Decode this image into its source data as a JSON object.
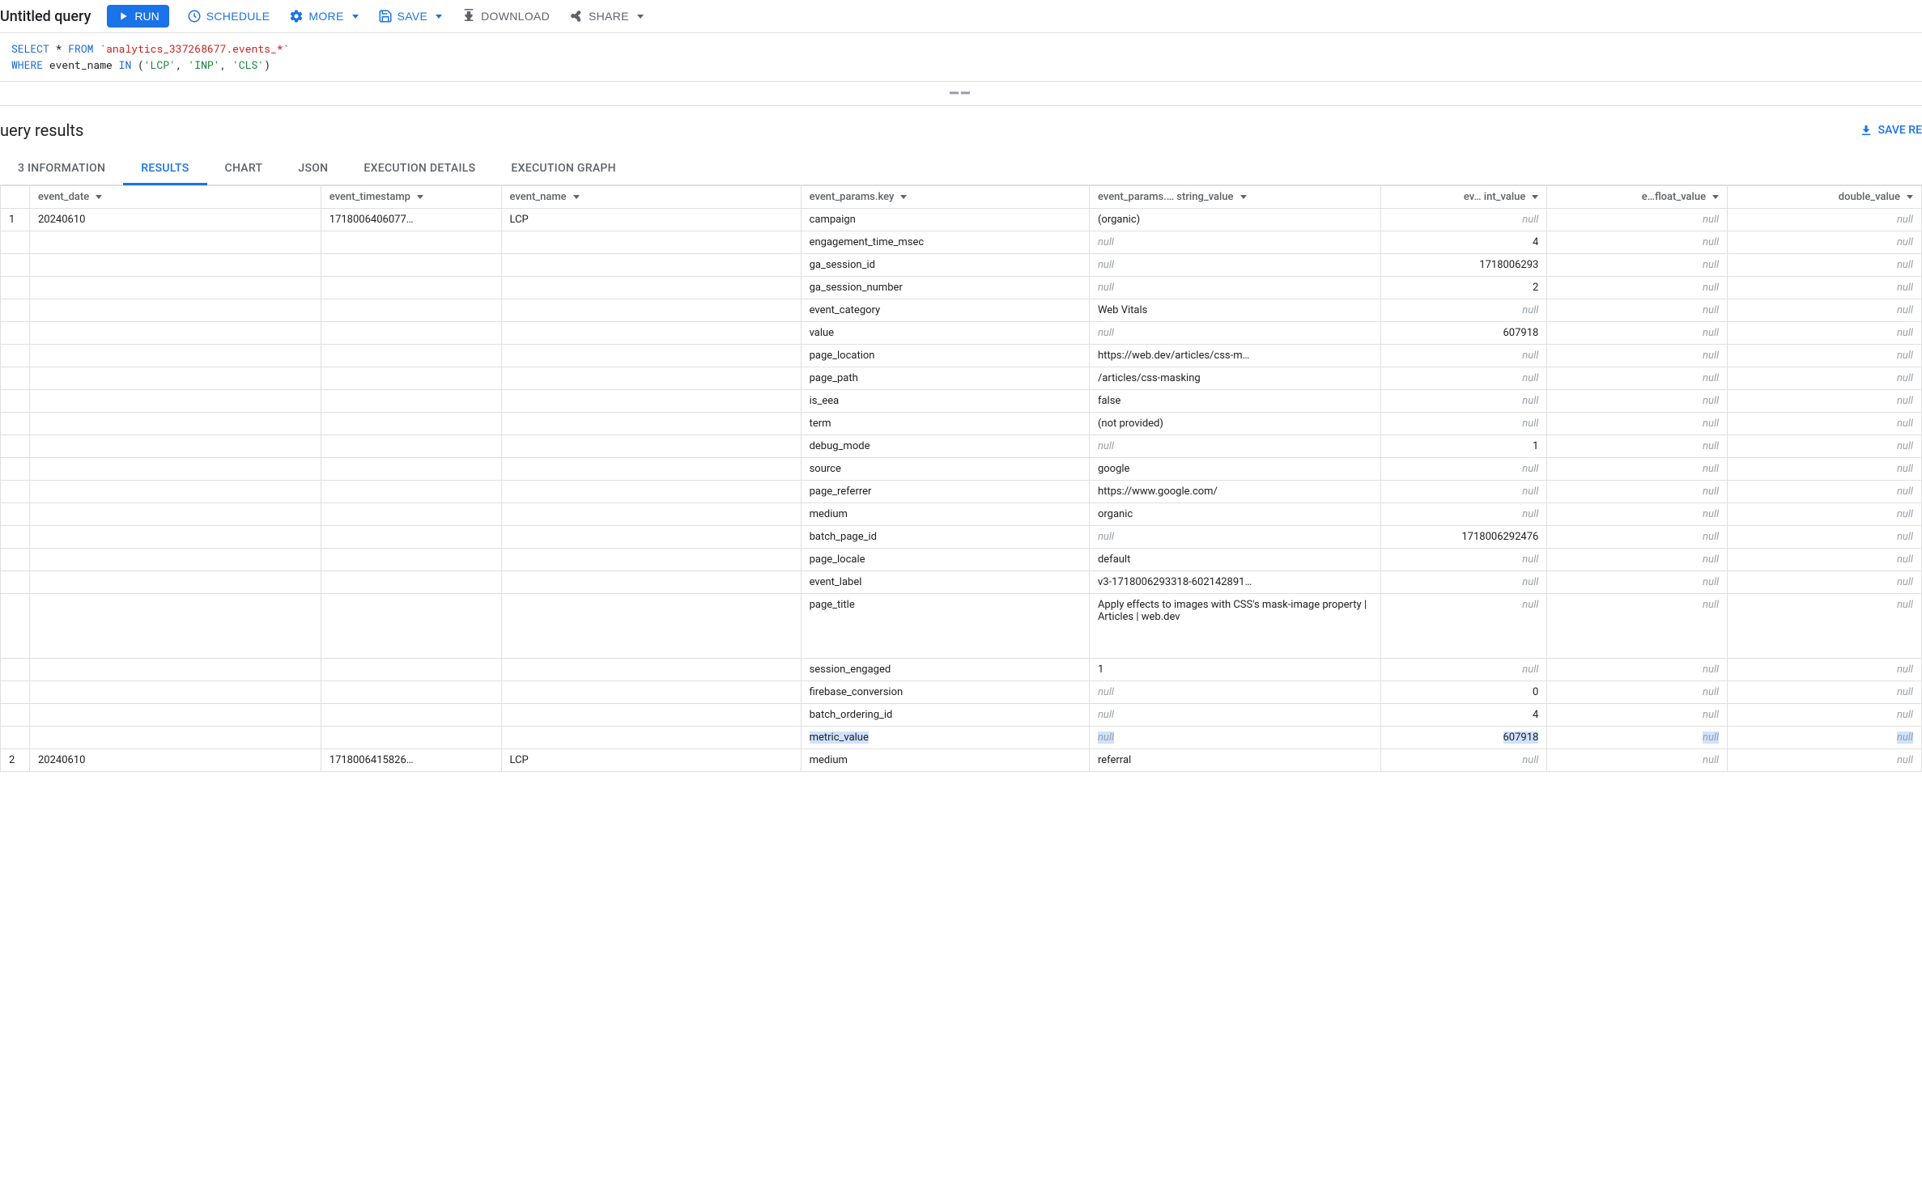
{
  "toolbar": {
    "title": "Untitled query",
    "run": "RUN",
    "schedule": "SCHEDULE",
    "more": "MORE",
    "save": "SAVE",
    "download": "DOWNLOAD",
    "share": "SHARE"
  },
  "sql": {
    "select": "SELECT",
    "star": "*",
    "from": "FROM",
    "table": "`analytics_337268677.events_*`",
    "where": "WHERE",
    "col": "event_name",
    "in": "IN",
    "vals": [
      "'LCP'",
      "'INP'",
      "'CLS'"
    ]
  },
  "results": {
    "title": "uery results",
    "save": "SAVE RE"
  },
  "tabs": [
    "3 INFORMATION",
    "RESULTS",
    "CHART",
    "JSON",
    "EXECUTION DETAILS",
    "EXECUTION GRAPH"
  ],
  "active_tab": 1,
  "columns": [
    {
      "label": "",
      "cls": "colw-rownum"
    },
    {
      "label": "event_date",
      "cls": "colw-date"
    },
    {
      "label": "event_timestamp",
      "cls": "colw-ts"
    },
    {
      "label": "event_name",
      "cls": "colw-ename"
    },
    {
      "label": "event_params.key",
      "cls": "colw-key"
    },
    {
      "label": "event_params.… string_value",
      "cls": "colw-str"
    },
    {
      "label": "ev… int_value",
      "cls": "colw-int num"
    },
    {
      "label": "e…float_value",
      "cls": "colw-float num"
    },
    {
      "label": "double_value",
      "cls": "colw-double num"
    }
  ],
  "rows": [
    {
      "rownum": "1",
      "date": "20240610",
      "ts": "1718006406077…",
      "ename": "LCP",
      "params": [
        {
          "key": "campaign",
          "str": "(organic)",
          "int": null,
          "float": null,
          "double": null
        },
        {
          "key": "engagement_time_msec",
          "str": null,
          "int": "4",
          "float": null,
          "double": null
        },
        {
          "key": "ga_session_id",
          "str": null,
          "int": "1718006293",
          "float": null,
          "double": null
        },
        {
          "key": "ga_session_number",
          "str": null,
          "int": "2",
          "float": null,
          "double": null
        },
        {
          "key": "event_category",
          "str": "Web Vitals",
          "int": null,
          "float": null,
          "double": null
        },
        {
          "key": "value",
          "str": null,
          "int": "607918",
          "float": null,
          "double": null
        },
        {
          "key": "page_location",
          "str": "https://web.dev/articles/css-m…",
          "int": null,
          "float": null,
          "double": null
        },
        {
          "key": "page_path",
          "str": "/articles/css-masking",
          "int": null,
          "float": null,
          "double": null
        },
        {
          "key": "is_eea",
          "str": "false",
          "int": null,
          "float": null,
          "double": null
        },
        {
          "key": "term",
          "str": "(not provided)",
          "int": null,
          "float": null,
          "double": null
        },
        {
          "key": "debug_mode",
          "str": null,
          "int": "1",
          "float": null,
          "double": null
        },
        {
          "key": "source",
          "str": "google",
          "int": null,
          "float": null,
          "double": null
        },
        {
          "key": "page_referrer",
          "str": "https://www.google.com/",
          "int": null,
          "float": null,
          "double": null
        },
        {
          "key": "medium",
          "str": "organic",
          "int": null,
          "float": null,
          "double": null
        },
        {
          "key": "batch_page_id",
          "str": null,
          "int": "1718006292476",
          "float": null,
          "double": null
        },
        {
          "key": "page_locale",
          "str": "default",
          "int": null,
          "float": null,
          "double": null
        },
        {
          "key": "event_label",
          "str": "v3-1718006293318-602142891…",
          "int": null,
          "float": null,
          "double": null
        },
        {
          "key": "page_title",
          "str": "Apply effects to images with CSS's mask-image property  |  Articles  |  web.dev",
          "int": null,
          "float": null,
          "double": null,
          "tall": true
        },
        {
          "key": "session_engaged",
          "str": "1",
          "int": null,
          "float": null,
          "double": null
        },
        {
          "key": "firebase_conversion",
          "str": null,
          "int": "0",
          "float": null,
          "double": null
        },
        {
          "key": "batch_ordering_id",
          "str": null,
          "int": "4",
          "float": null,
          "double": null
        },
        {
          "key": "metric_value",
          "str": null,
          "int": "607918",
          "float": null,
          "double": null,
          "highlight": true
        }
      ]
    },
    {
      "rownum": "2",
      "date": "20240610",
      "ts": "1718006415826…",
      "ename": "LCP",
      "params": [
        {
          "key": "medium",
          "str": "referral",
          "int": null,
          "float": null,
          "double": null
        }
      ]
    }
  ]
}
